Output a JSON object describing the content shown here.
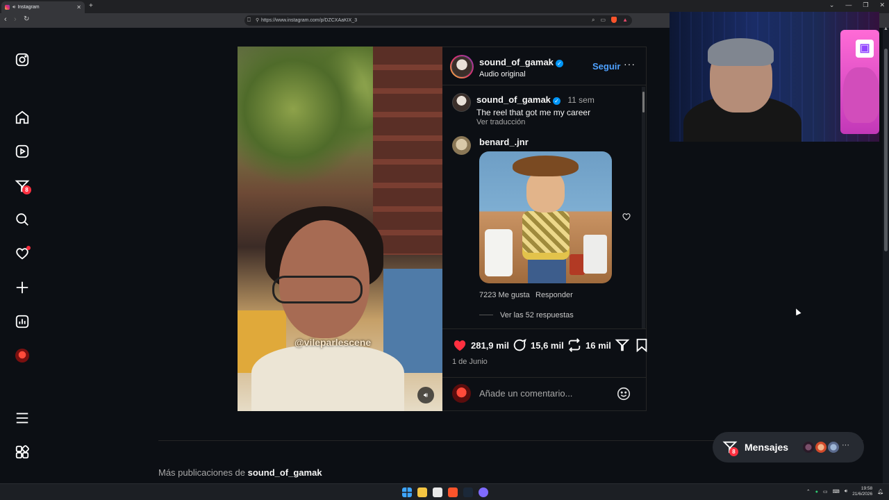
{
  "browser": {
    "tab_title": "Instagram",
    "new_tab": "+",
    "url": "https://www.instagram.com/p/DZCXAaKIX_3",
    "window_controls": [
      "⌄",
      "—",
      "❐",
      "✕"
    ]
  },
  "sidebar": {
    "items": [
      {
        "name": "instagram-logo-icon"
      },
      {
        "name": "home-icon"
      },
      {
        "name": "reels-icon"
      },
      {
        "name": "messages-icon",
        "badge": "8"
      },
      {
        "name": "search-icon"
      },
      {
        "name": "notifications-icon"
      },
      {
        "name": "create-icon"
      },
      {
        "name": "dashboard-icon"
      },
      {
        "name": "profile-icon"
      },
      {
        "name": "menu-icon"
      },
      {
        "name": "more-apps-icon"
      }
    ]
  },
  "post": {
    "watermark": "@vileparlescene",
    "author": {
      "username": "sound_of_gamak",
      "subtitle": "Audio original",
      "follow_label": "Seguir",
      "more": "···"
    },
    "caption": {
      "username": "sound_of_gamak",
      "time": "11 sem",
      "text": "The reel that got me my career",
      "translate": "Ver traducción"
    },
    "comment": {
      "username": "benard_.jnr",
      "likes": "7223 Me gusta",
      "reply": "Responder",
      "view_replies": "Ver las 52 respuestas"
    },
    "actions": {
      "likes": "281,9 mil",
      "comments": "15,6 mil",
      "reposts": "16 mil"
    },
    "date": "1 de Junio",
    "comment_placeholder": "Añade un comentario..."
  },
  "more_posts": {
    "prefix": "Más publicaciones de ",
    "username": "sound_of_gamak"
  },
  "messages": {
    "label": "Mensajes",
    "badge": "8",
    "more": "···"
  },
  "taskbar": {
    "time": "19:58",
    "date": "21/6/2026"
  },
  "colors": {
    "like": "#ff3040",
    "link": "#4ea1ff",
    "badge": "#ff3040",
    "verified": "#0095f6"
  }
}
